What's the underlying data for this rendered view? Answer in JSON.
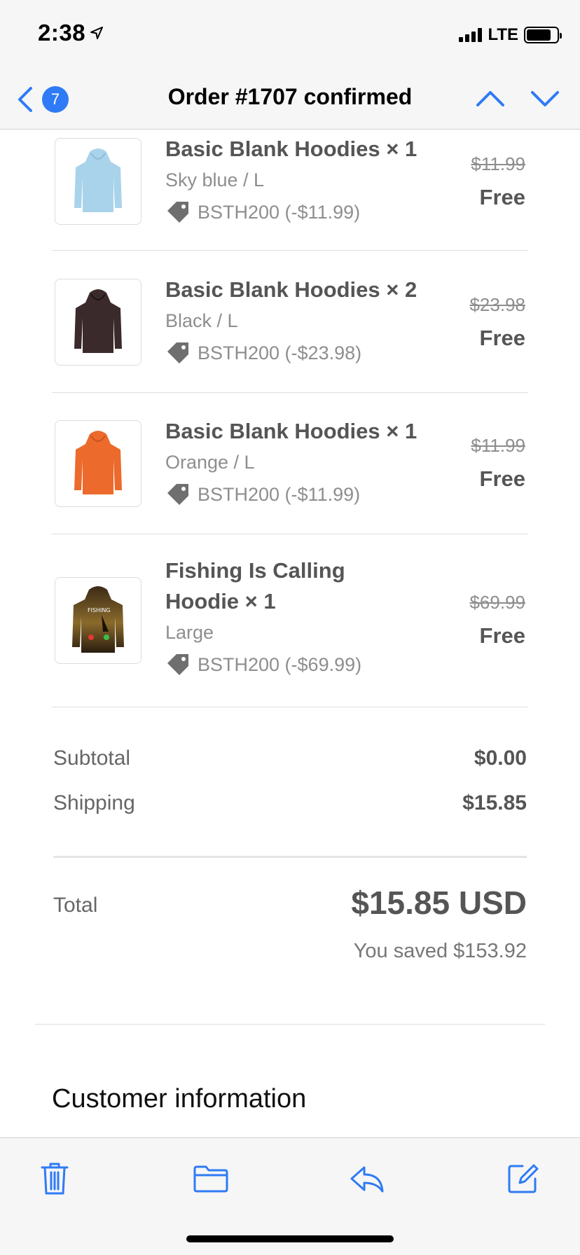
{
  "status_bar": {
    "time": "2:38",
    "network": "LTE"
  },
  "nav": {
    "back_count": "7",
    "title": "Order #1707 confirmed"
  },
  "items": [
    {
      "name": "Basic Blank Hoodies × 1",
      "variant": "Sky blue / L",
      "discount": "BSTH200 (-$11.99)",
      "old_price": "$11.99",
      "new_price": "Free",
      "image_icon": "hoodie-sky-blue"
    },
    {
      "name": "Basic Blank Hoodies × 2",
      "variant": "Black / L",
      "discount": "BSTH200 (-$23.98)",
      "old_price": "$23.98",
      "new_price": "Free",
      "image_icon": "hoodie-black"
    },
    {
      "name": "Basic Blank Hoodies × 1",
      "variant": "Orange / L",
      "discount": "BSTH200 (-$11.99)",
      "old_price": "$11.99",
      "new_price": "Free",
      "image_icon": "hoodie-orange"
    },
    {
      "name_line1": "Fishing Is Calling",
      "name_line2": "Hoodie × 1",
      "variant": "Large",
      "discount": "BSTH200 (-$69.99)",
      "old_price": "$69.99",
      "new_price": "Free",
      "image_icon": "hoodie-fishing-print",
      "print_text": "FISHING"
    }
  ],
  "summary": {
    "subtotal_label": "Subtotal",
    "subtotal_value": "$0.00",
    "shipping_label": "Shipping",
    "shipping_value": "$15.85",
    "total_label": "Total",
    "total_value": "$15.85 USD",
    "saved": "You saved $153.92"
  },
  "section": {
    "customer_info": "Customer information"
  },
  "toolbar": {
    "icons": [
      "trash-icon",
      "folder-icon",
      "reply-icon",
      "compose-icon"
    ]
  },
  "colors": {
    "accent": "#2f7bf5",
    "muted_text": "#8e8e8e",
    "strong_text": "#555555",
    "bar_bg": "#f6f6f6"
  }
}
